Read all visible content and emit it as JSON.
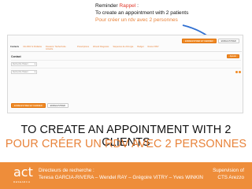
{
  "reminder": {
    "title_prefix": "Reminder ",
    "title_highlight": "Rappel",
    "title_suffix": " :",
    "english": "To create an appointment with 2 patients",
    "french": "Pour créer un rdv avec 2 personnes"
  },
  "app": {
    "top_buttons": [
      "ENREGISTRER ET FERMER",
      "ENREGISTRER"
    ],
    "tabs": [
      "Contacts",
      "Info RDV & Pédiatrie",
      "Dossiers: Tâche/Code Actuelle",
      "Prescriptions",
      "Wound Diagnosis",
      "Séquence de chirurgie",
      "Budget",
      "Retour RDV"
    ],
    "section_label": "Contact",
    "add_label": "Ajouter",
    "rows": [
      {
        "select_text": "Recherche Patient"
      },
      {
        "select_text": "Recherche Patient"
      }
    ],
    "bottom_buttons": [
      "ENREGISTRER ET FERMER",
      "ENREGISTRER"
    ]
  },
  "headings": {
    "english": "TO CREATE AN APPOINTMENT WITH 2 CLIENTS",
    "french": "POUR CRÉER UN RDV AVEC 2 PERSONNES"
  },
  "footer": {
    "logo_text": "act",
    "logo_sub": "RESEARCH",
    "directors_label": "Directeurs de recherche :",
    "directors_names": "Teresa GARCIA-RIVERA – Wendel RAY – Grégoire VITRY – Yves WINKIN",
    "supervision_label": "Supervision of",
    "supervision_name": "CTS Arezzo"
  },
  "colors": {
    "accent_orange": "#ee8d3a",
    "highlight_red": "#e0372a",
    "arrow_blue": "#2f6fd1"
  }
}
